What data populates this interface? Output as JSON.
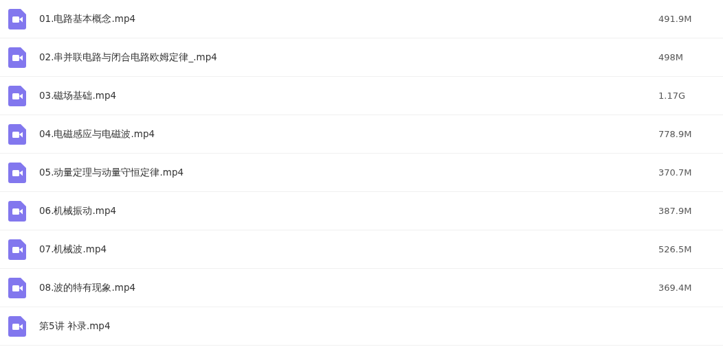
{
  "files": [
    {
      "name": "01.电路基本概念.mp4",
      "size": "491.9M"
    },
    {
      "name": "02.串并联电路与闭合电路欧姆定律_.mp4",
      "size": "498M"
    },
    {
      "name": "03.磁场基础.mp4",
      "size": "1.17G"
    },
    {
      "name": "04.电磁感应与电磁波.mp4",
      "size": "778.9M"
    },
    {
      "name": "05.动量定理与动量守恒定律.mp4",
      "size": "370.7M"
    },
    {
      "name": "06.机械振动.mp4",
      "size": "387.9M"
    },
    {
      "name": "07.机械波.mp4",
      "size": "526.5M"
    },
    {
      "name": "08.波的特有现象.mp4",
      "size": "369.4M"
    },
    {
      "name": "第5讲 补录.mp4"
    }
  ]
}
